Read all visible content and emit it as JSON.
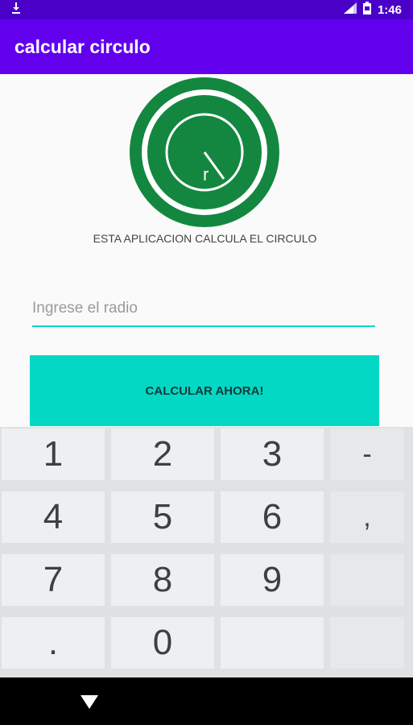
{
  "status_bar": {
    "time": "1:46"
  },
  "app_bar": {
    "title": "calcular circulo"
  },
  "main": {
    "description": "ESTA APLICACION CALCULA EL CIRCULO",
    "radius_input": {
      "placeholder": "Ingrese el radio",
      "value": ""
    },
    "calculate_button_label": "CALCULAR AHORA!"
  },
  "keyboard": {
    "rows": [
      [
        "1",
        "2",
        "3",
        "-"
      ],
      [
        "4",
        "5",
        "6",
        ","
      ],
      [
        "7",
        "8",
        "9",
        ""
      ],
      [
        ".",
        "0",
        "",
        ""
      ]
    ]
  },
  "colors": {
    "status_bar": "#4b00c8",
    "app_bar": "#6200ee",
    "accent": "#03dac5",
    "logo_green": "#13873f"
  },
  "icons": {
    "nav_back": "chevron-down-icon",
    "logo": "circle-radius-logo",
    "notification": "download-icon",
    "signal": "signal-icon",
    "battery": "battery-icon"
  }
}
